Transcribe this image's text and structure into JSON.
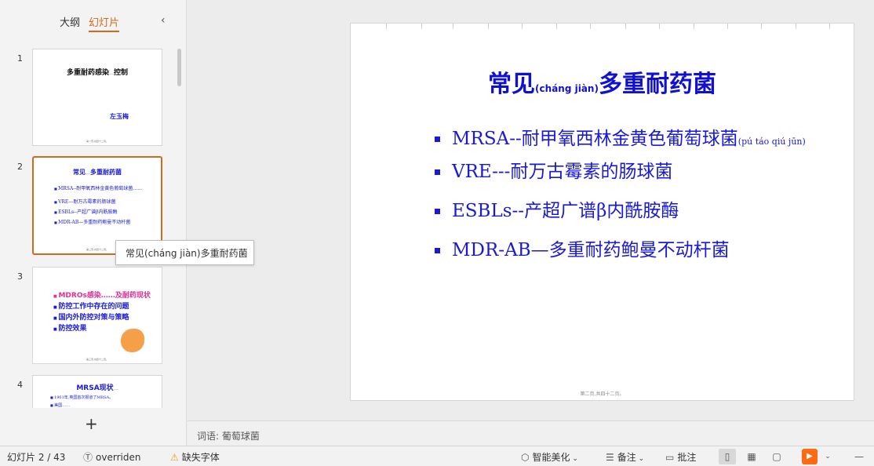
{
  "panel": {
    "tab_outline": "大纲",
    "tab_slides": "幻灯片",
    "collapse_icon": "‹",
    "add_slide_icon": "+"
  },
  "thumbs": [
    {
      "num": "1",
      "title_a": "多重耐药感染",
      "title_small": "……",
      "title_b": "控制",
      "author": "左玉梅",
      "footer": "第一页,共四十二页。"
    },
    {
      "num": "2",
      "title_a": "常见",
      "title_small": "……",
      "title_b": "多重耐药菌",
      "bullets": [
        "MRSA--耐甲氧西林金黄色葡萄球菌……",
        "VRE---耐万古霉素的肠球菌",
        "ESBLs--产超广谱β内酰胺酶",
        "MDR-AB—多重耐药鲍曼不动杆菌"
      ],
      "footer": "第二页,共四十二页。"
    },
    {
      "num": "3",
      "bullets": [
        "MDROs感染……及耐药现状",
        "防控工作中存在的问题",
        "国内外防控对策与策略",
        "防控效果"
      ],
      "footer": "第三页,共四十二页。"
    },
    {
      "num": "4",
      "title": "MRSA现状",
      "title_small": "……",
      "bullets": [
        "1961年,英国首次报道了MRSA。",
        "美国……"
      ]
    }
  ],
  "tooltip": "常见(cháng jiàn)多重耐药菌",
  "slide": {
    "title_a": "常见",
    "title_pinyin": "(cháng jiàn)",
    "title_b": "多重耐药菌",
    "bullets": [
      {
        "text": "MRSA--耐甲氧西林金黄色葡萄球菌",
        "pinyin": "(pú táo qiú jūn)"
      },
      {
        "text": "VRE---耐万古霉素的肠球菌"
      },
      {
        "text": "ESBLs--产超广谱β内酰胺酶"
      },
      {
        "text": "MDR-AB—多重耐药鲍曼不动杆菌"
      }
    ],
    "footer": "第二页,共四十二页。"
  },
  "notes": "词语: 葡萄球菌",
  "status": {
    "slide_counter": "幻灯片 2 / 43",
    "overridden": "overriden",
    "missing_font": "缺失字体",
    "beautify": "智能美化",
    "notes": "备注",
    "comments": "批注"
  }
}
